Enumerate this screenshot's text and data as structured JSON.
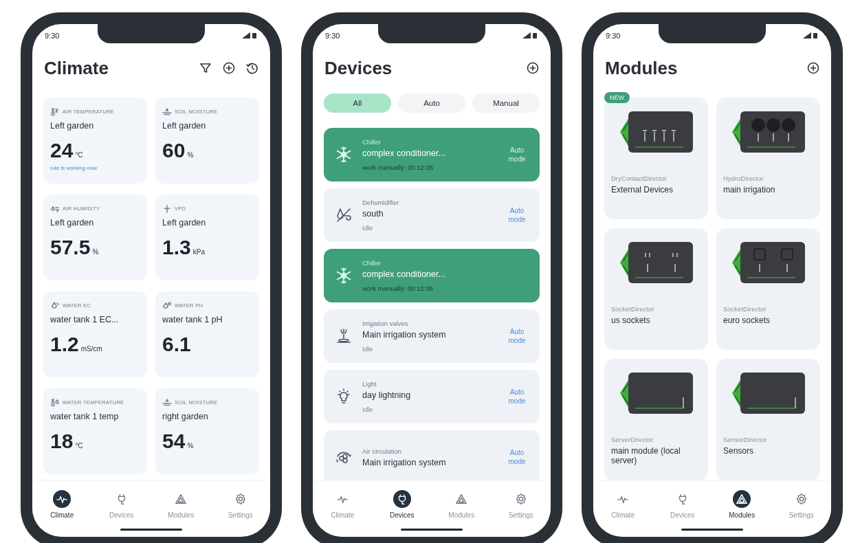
{
  "screens": [
    {
      "kind": "climate",
      "time": "9:30",
      "title": "Climate",
      "cards": [
        {
          "kind": "air_temperature",
          "label": "AIR TEMPERATURE",
          "place": "Left garden",
          "value": "24",
          "unit": "°C",
          "note": "rule is working now"
        },
        {
          "kind": "soil_moisture",
          "label": "SOIL MOISTURE",
          "place": "Left garden",
          "value": "60",
          "unit": "%"
        },
        {
          "kind": "air_humidity",
          "label": "AIR HUMIDITY",
          "place": "Left garden",
          "value": "57.5",
          "unit": "%"
        },
        {
          "kind": "vpd",
          "label": "VPD",
          "place": "Left garden",
          "value": "1.3",
          "unit": "kPa"
        },
        {
          "kind": "water_ec",
          "label": "WATER EC",
          "place": "water tank 1 EC...",
          "value": "1.2",
          "unit": "mS/cm"
        },
        {
          "kind": "water_ph",
          "label": "WATER PH",
          "place": "water tank 1 pH",
          "value": "6.1"
        },
        {
          "kind": "water_temperature",
          "label": "WATER TEMPERATURE",
          "place": "water tank 1 temp",
          "value": "18",
          "unit": "°C"
        },
        {
          "kind": "soil_moisture",
          "label": "SOIL MOISTURE",
          "place": "right garden",
          "value": "54",
          "unit": "%"
        }
      ],
      "nav": [
        {
          "label": "Climate",
          "selected": true
        },
        {
          "label": "Devices",
          "selected": false
        },
        {
          "label": "Modules",
          "selected": false
        },
        {
          "label": "Settings",
          "selected": false
        }
      ]
    },
    {
      "kind": "devices",
      "time": "9:30",
      "title": "Devices",
      "filters": [
        {
          "label": "All",
          "selected": true
        },
        {
          "label": "Auto",
          "selected": false
        },
        {
          "label": "Manual",
          "selected": false
        }
      ],
      "devices": [
        {
          "kind": "chiller",
          "active": true,
          "type": "Chiller",
          "name": "complex conditioner...",
          "status": "work manually: 00:12:05",
          "mode": "Auto mode"
        },
        {
          "kind": "dehumidifier",
          "active": false,
          "type": "Dehumidifier",
          "name": "south",
          "status": "Idle",
          "mode": "Auto mode"
        },
        {
          "kind": "chiller",
          "active": true,
          "type": "Chiller",
          "name": "complex conditioner...",
          "status": "work manually: 00:12:05"
        },
        {
          "kind": "irrigation",
          "active": false,
          "type": "Irrigation valves",
          "name": "Main irrigation system",
          "status": "Idle",
          "mode": "Auto mode"
        },
        {
          "kind": "light",
          "active": false,
          "type": "Light",
          "name": "day lightning",
          "status": "Idle",
          "mode": "Auto mode"
        },
        {
          "kind": "circulation",
          "active": false,
          "type": "Air circulation",
          "name": "Main irrigation system",
          "mode": "Auto mode"
        }
      ],
      "nav": [
        {
          "label": "Climate",
          "selected": false
        },
        {
          "label": "Devices",
          "selected": true
        },
        {
          "label": "Modules",
          "selected": false
        },
        {
          "label": "Settings",
          "selected": false
        }
      ]
    },
    {
      "kind": "modules",
      "time": "9:30",
      "title": "Modules",
      "modules": [
        {
          "kind": "dry_contact",
          "badge": "NEW",
          "type": "DryContactDirector",
          "name": "External Devices"
        },
        {
          "kind": "hydro",
          "type": "HydroDirector",
          "name": "main irrigation"
        },
        {
          "kind": "us_socket",
          "type": "SocketDirector",
          "name": "us sockets"
        },
        {
          "kind": "euro_socket",
          "type": "SocketDirector",
          "name": "euro sockets"
        },
        {
          "kind": "server",
          "type": "ServerDirector",
          "name": "main module (local server)"
        },
        {
          "kind": "sensor",
          "type": "SensorDirector",
          "name": "Sensors"
        }
      ],
      "nav": [
        {
          "label": "Climate",
          "selected": false
        },
        {
          "label": "Devices",
          "selected": false
        },
        {
          "label": "Modules",
          "selected": true
        },
        {
          "label": "Settings",
          "selected": false
        }
      ]
    }
  ]
}
